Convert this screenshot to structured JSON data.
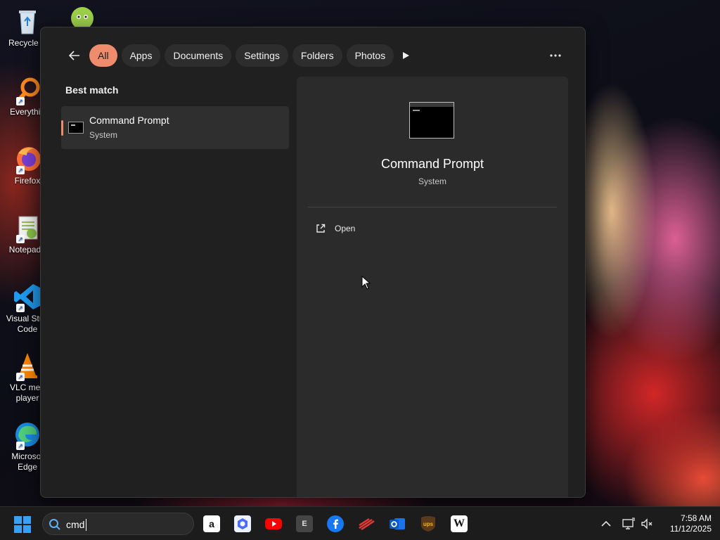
{
  "desktop": {
    "icons": [
      {
        "label": "Recycle B",
        "icon": "recycle-bin-icon"
      },
      {
        "label": "Everythin",
        "icon": "everything-search-icon"
      },
      {
        "label": "Firefox",
        "icon": "firefox-icon"
      },
      {
        "label": "Notepad+",
        "icon": "notepad-plus-plus-icon"
      },
      {
        "label": "Visual Stud\nCode",
        "line1": "Visual Stud",
        "line2": "Code",
        "icon": "vscode-icon"
      },
      {
        "label": "VLC med\nplayer",
        "line1": "VLC med",
        "line2": "player",
        "icon": "vlc-icon"
      },
      {
        "label": "Microsof\nEdge",
        "line1": "Microsof",
        "line2": "Edge",
        "icon": "edge-icon"
      }
    ]
  },
  "search_panel": {
    "filters": [
      "All",
      "Apps",
      "Documents",
      "Settings",
      "Folders",
      "Photos"
    ],
    "active_filter": "All",
    "section_title": "Best match",
    "best_match": {
      "name": "Command Prompt",
      "type": "System"
    },
    "preview": {
      "name": "Command Prompt",
      "type": "System",
      "actions": [
        {
          "label": "Open",
          "icon": "open-external-icon"
        }
      ]
    }
  },
  "taskbar": {
    "search_value": "cmd",
    "pinned_apps": [
      "amazon-icon",
      "copilot-icon",
      "youtube-icon",
      "epic-games-icon",
      "facebook-icon",
      "app-red-icon",
      "outlook-icon",
      "ups-icon",
      "wikipedia-icon"
    ],
    "clock": {
      "time": "7:58 AM",
      "date": "11/12/2025"
    }
  },
  "colors": {
    "accent": "#f08c6e",
    "panel_bg": "#202020",
    "preview_bg": "#2b2b2b",
    "taskbar_bg": "#1c1c1c"
  }
}
